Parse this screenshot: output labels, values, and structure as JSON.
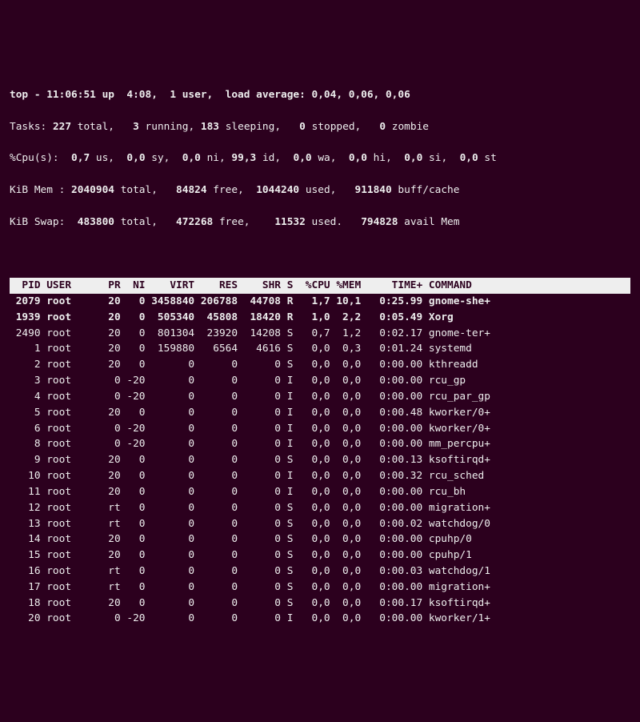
{
  "summary": {
    "line1": "top - 11:06:51 up  4:08,  1 user,  load average: 0,04, 0,06, 0,06",
    "tasks": {
      "pre": "Tasks: ",
      "total": "227",
      "t_lbl": " total,   ",
      "run": "3",
      "r_lbl": " running, ",
      "sleep": "183",
      "s_lbl": " sleeping,   ",
      "stop": "0",
      "st_lbl": " stopped,   ",
      "zomb": "0",
      "z_lbl": " zombie"
    },
    "cpu": {
      "pre": "%Cpu(s):  ",
      "us": "0,7",
      "us_l": " us,  ",
      "sy": "0,0",
      "sy_l": " sy,  ",
      "ni": "0,0",
      "ni_l": " ni, ",
      "id": "99,3",
      "id_l": " id,  ",
      "wa": "0,0",
      "wa_l": " wa,  ",
      "hi": "0,0",
      "hi_l": " hi,  ",
      "si": "0,0",
      "si_l": " si,  ",
      "st": "0,0",
      "st_l": " st"
    },
    "mem": {
      "pre": "KiB Mem : ",
      "total": "2040904",
      "t_l": " total,   ",
      "free": "84824",
      "f_l": " free,  ",
      "used": "1044240",
      "u_l": " used,   ",
      "buff": "911840",
      "b_l": " buff/cache"
    },
    "swap": {
      "pre": "KiB Swap:  ",
      "total": "483800",
      "t_l": " total,   ",
      "free": "472268",
      "f_l": " free,    ",
      "used": "11532",
      "u_l": " used.   ",
      "avail": "794828",
      "a_l": " avail Mem "
    }
  },
  "header": "  PID USER      PR  NI    VIRT    RES    SHR S  %CPU %MEM     TIME+ COMMAND    ",
  "rows": [
    {
      "r": true,
      "t": " 2079 root      20   0 3458840 206788  44708 R   1,7 10,1   0:25.99 gnome-she+ "
    },
    {
      "r": true,
      "t": " 1939 root      20   0  505340  45808  18420 R   1,0  2,2   0:05.49 Xorg       "
    },
    {
      "r": false,
      "t": " 2490 root      20   0  801304  23920  14208 S   0,7  1,2   0:02.17 gnome-ter+ "
    },
    {
      "r": false,
      "t": "    1 root      20   0  159880   6564   4616 S   0,0  0,3   0:01.24 systemd    "
    },
    {
      "r": false,
      "t": "    2 root      20   0       0      0      0 S   0,0  0,0   0:00.00 kthreadd   "
    },
    {
      "r": false,
      "t": "    3 root       0 -20       0      0      0 I   0,0  0,0   0:00.00 rcu_gp     "
    },
    {
      "r": false,
      "t": "    4 root       0 -20       0      0      0 I   0,0  0,0   0:00.00 rcu_par_gp "
    },
    {
      "r": false,
      "t": "    5 root      20   0       0      0      0 I   0,0  0,0   0:00.48 kworker/0+ "
    },
    {
      "r": false,
      "t": "    6 root       0 -20       0      0      0 I   0,0  0,0   0:00.00 kworker/0+ "
    },
    {
      "r": false,
      "t": "    8 root       0 -20       0      0      0 I   0,0  0,0   0:00.00 mm_percpu+ "
    },
    {
      "r": false,
      "t": "    9 root      20   0       0      0      0 S   0,0  0,0   0:00.13 ksoftirqd+ "
    },
    {
      "r": false,
      "t": "   10 root      20   0       0      0      0 I   0,0  0,0   0:00.32 rcu_sched  "
    },
    {
      "r": false,
      "t": "   11 root      20   0       0      0      0 I   0,0  0,0   0:00.00 rcu_bh     "
    },
    {
      "r": false,
      "t": "   12 root      rt   0       0      0      0 S   0,0  0,0   0:00.00 migration+ "
    },
    {
      "r": false,
      "t": "   13 root      rt   0       0      0      0 S   0,0  0,0   0:00.02 watchdog/0 "
    },
    {
      "r": false,
      "t": "   14 root      20   0       0      0      0 S   0,0  0,0   0:00.00 cpuhp/0    "
    },
    {
      "r": false,
      "t": "   15 root      20   0       0      0      0 S   0,0  0,0   0:00.00 cpuhp/1    "
    },
    {
      "r": false,
      "t": "   16 root      rt   0       0      0      0 S   0,0  0,0   0:00.03 watchdog/1 "
    },
    {
      "r": false,
      "t": "   17 root      rt   0       0      0      0 S   0,0  0,0   0:00.00 migration+ "
    },
    {
      "r": false,
      "t": "   18 root      20   0       0      0      0 S   0,0  0,0   0:00.17 ksoftirqd+ "
    },
    {
      "r": false,
      "t": "   20 root       0 -20       0      0      0 I   0,0  0,0   0:00.00 kworker/1+ "
    }
  ]
}
